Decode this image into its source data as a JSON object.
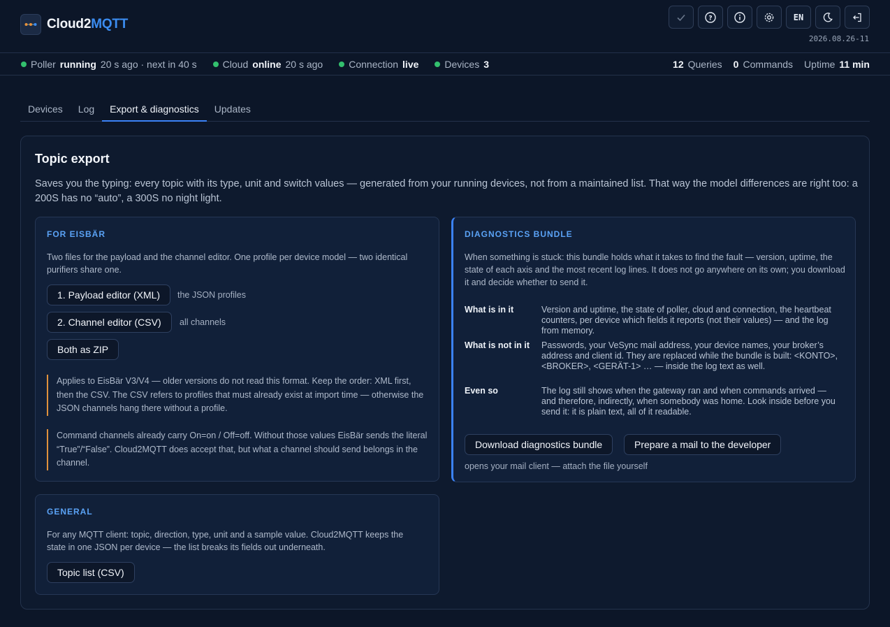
{
  "app": {
    "brand_main": "Cloud2",
    "brand_accent": "MQTT",
    "date": "2026.08.26-11"
  },
  "header_icons": [
    {
      "name": "check-icon",
      "label": "✓"
    },
    {
      "name": "help-icon",
      "label": "?"
    },
    {
      "name": "info-icon",
      "label": "i"
    },
    {
      "name": "gear-icon",
      "label": "⚙"
    },
    {
      "name": "language-button",
      "label": "EN"
    },
    {
      "name": "moon-icon",
      "label": "☾"
    },
    {
      "name": "logout-icon",
      "label": "⇤"
    }
  ],
  "status": {
    "poller": {
      "label": "Poller",
      "value": "running",
      "detail": "20 s ago · next in 40 s"
    },
    "cloud": {
      "label": "Cloud",
      "value": "online",
      "detail": "20 s ago"
    },
    "connection": {
      "label": "Connection",
      "value": "live"
    },
    "devices": {
      "label": "Devices",
      "value": "3"
    },
    "queries_count": "12",
    "queries_label": "Queries",
    "commands_count": "0",
    "commands_label": "Commands",
    "uptime_label": "Uptime",
    "uptime_value": "11 min"
  },
  "tabs": [
    {
      "label": "Devices",
      "active": false
    },
    {
      "label": "Log",
      "active": false
    },
    {
      "label": "Export & diagnostics",
      "active": true
    },
    {
      "label": "Updates",
      "active": false
    }
  ],
  "topic_export": {
    "title": "Topic export",
    "description": "Saves you the typing: every topic with its type, unit and switch values — generated from your running devices, not from a maintained list. That way the model differences are right too: a 200S has no “auto”, a 300S no night light."
  },
  "eisbaer": {
    "title": "FOR EISBÄR",
    "description": "Two files for the payload and the channel editor. One profile per device model — two identical purifiers share one.",
    "btn_payload": "1. Payload editor (XML)",
    "btn_payload_note": "the JSON profiles",
    "btn_channel": "2. Channel editor (CSV)",
    "btn_channel_note": "all channels",
    "btn_zip": "Both as ZIP",
    "note1": "Applies to EisBär V3/V4 — older versions do not read this format. Keep the order: XML first, then the CSV. The CSV refers to profiles that must already exist at import time — otherwise the JSON channels hang there without a profile.",
    "note2": "Command channels already carry On=on / Off=off. Without those values EisBär sends the literal “True”/“False”. Cloud2MQTT does accept that, but what a channel should send belongs in the channel."
  },
  "general": {
    "title": "GENERAL",
    "description": "For any MQTT client: topic, direction, type, unit and a sample value. Cloud2MQTT keeps the state in one JSON per device — the list breaks its fields out underneath.",
    "btn_topic_list": "Topic list (CSV)"
  },
  "diagnostics": {
    "title": "DIAGNOSTICS BUNDLE",
    "description": "When something is stuck: this bundle holds what it takes to find the fault — version, uptime, the state of each axis and the most recent log lines. It does not go anywhere on its own; you download it and decide whether to send it.",
    "in_label": "What is in it",
    "in_value": "Version and uptime, the state of poller, cloud and connection, the heartbeat counters, per device which fields it reports (not their values) — and the log from memory.",
    "not_label": "What is not in it",
    "not_value": "Passwords, your VeSync mail address, your device names, your broker’s address and client id. They are replaced while the bundle is built: <KONTO>, <BROKER>, <GERÄT-1> … — inside the log text as well.",
    "even_label": "Even so",
    "even_value": "The log still shows when the gateway ran and when commands arrived — and therefore, indirectly, when somebody was home. Look inside before you send it: it is plain text, all of it readable.",
    "btn_download": "Download diagnostics bundle",
    "btn_mail": "Prepare a mail to the developer",
    "mail_note": "opens your mail client — attach the file yourself"
  }
}
